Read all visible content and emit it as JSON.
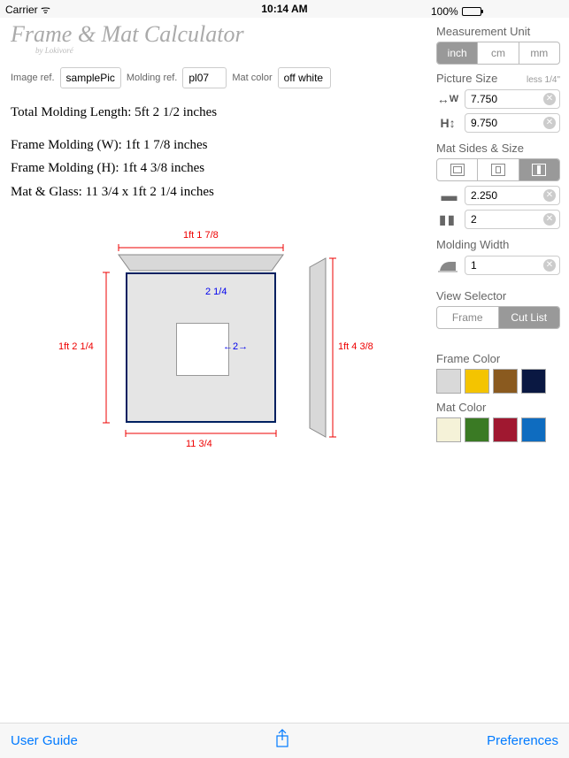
{
  "status": {
    "carrier": "Carrier",
    "time": "10:14 AM",
    "battery": "100%"
  },
  "title": "Frame & Mat Calculator",
  "subtitle": "by Lokivoré",
  "refs": {
    "image_label": "Image ref.",
    "image_value": "samplePic",
    "molding_label": "Molding ref.",
    "molding_value": "pl07",
    "matcolor_label": "Mat color",
    "matcolor_value": "off white"
  },
  "results": {
    "total": "Total Molding Length:  5ft  2  1/2  inches",
    "frame_w": "Frame Molding (W):  1ft  1  7/8  inches",
    "frame_h": "Frame Molding (H):  1ft  4  3/8  inches",
    "matglass": "Mat & Glass:  11  3/4 x 1ft  2  1/4  inches"
  },
  "diagram": {
    "top": "1ft  1  7/8",
    "left": "1ft  2  1/4",
    "right": "1ft  4  3/8",
    "bottom": "11  3/4",
    "mat_top": "2  1/4",
    "mat_side": "2"
  },
  "panel": {
    "unit_label": "Measurement Unit",
    "units": [
      "inch",
      "cm",
      "mm"
    ],
    "unit_active": 0,
    "pic_label": "Picture Size",
    "pic_sub": "less 1/4\"",
    "w_label": "W",
    "w_value": "7.750",
    "h_label": "H",
    "h_value": "9.750",
    "mat_label": "Mat Sides & Size",
    "mat_h_value": "2.250",
    "mat_v_value": "2",
    "molding_label": "Molding Width",
    "molding_value": "1",
    "view_label": "View Selector",
    "view_options": [
      "Frame",
      "Cut List"
    ],
    "view_active": 1,
    "frame_color_label": "Frame Color",
    "frame_colors": [
      "#d9d9d9",
      "#f4c400",
      "#8a5a1f",
      "#0a1842"
    ],
    "mat_color_label": "Mat Color",
    "mat_colors": [
      "#f5f2d8",
      "#3a7a24",
      "#a01830",
      "#0e6cc0"
    ]
  },
  "bottom": {
    "guide": "User Guide",
    "prefs": "Preferences"
  }
}
